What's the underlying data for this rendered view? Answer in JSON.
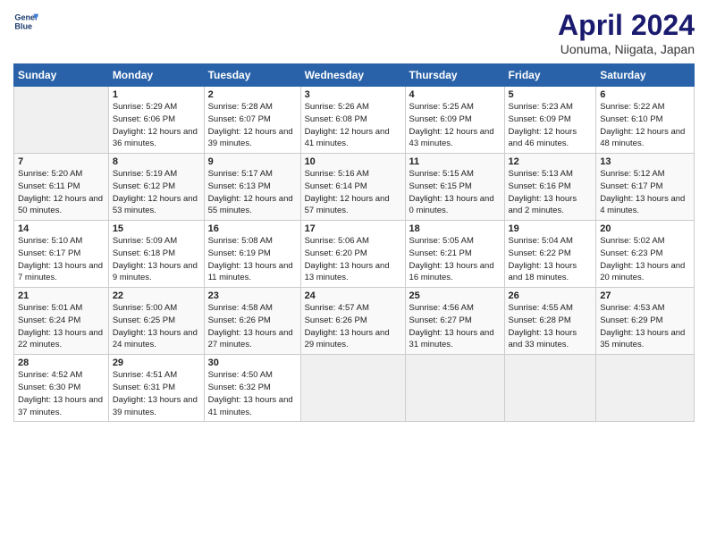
{
  "header": {
    "logo_line1": "General",
    "logo_line2": "Blue",
    "title": "April 2024",
    "subtitle": "Uonuma, Niigata, Japan"
  },
  "days_of_week": [
    "Sunday",
    "Monday",
    "Tuesday",
    "Wednesday",
    "Thursday",
    "Friday",
    "Saturday"
  ],
  "weeks": [
    [
      {
        "day": "",
        "empty": true
      },
      {
        "day": "1",
        "sunrise": "Sunrise: 5:29 AM",
        "sunset": "Sunset: 6:06 PM",
        "daylight": "Daylight: 12 hours and 36 minutes."
      },
      {
        "day": "2",
        "sunrise": "Sunrise: 5:28 AM",
        "sunset": "Sunset: 6:07 PM",
        "daylight": "Daylight: 12 hours and 39 minutes."
      },
      {
        "day": "3",
        "sunrise": "Sunrise: 5:26 AM",
        "sunset": "Sunset: 6:08 PM",
        "daylight": "Daylight: 12 hours and 41 minutes."
      },
      {
        "day": "4",
        "sunrise": "Sunrise: 5:25 AM",
        "sunset": "Sunset: 6:09 PM",
        "daylight": "Daylight: 12 hours and 43 minutes."
      },
      {
        "day": "5",
        "sunrise": "Sunrise: 5:23 AM",
        "sunset": "Sunset: 6:09 PM",
        "daylight": "Daylight: 12 hours and 46 minutes."
      },
      {
        "day": "6",
        "sunrise": "Sunrise: 5:22 AM",
        "sunset": "Sunset: 6:10 PM",
        "daylight": "Daylight: 12 hours and 48 minutes."
      }
    ],
    [
      {
        "day": "7",
        "sunrise": "Sunrise: 5:20 AM",
        "sunset": "Sunset: 6:11 PM",
        "daylight": "Daylight: 12 hours and 50 minutes."
      },
      {
        "day": "8",
        "sunrise": "Sunrise: 5:19 AM",
        "sunset": "Sunset: 6:12 PM",
        "daylight": "Daylight: 12 hours and 53 minutes."
      },
      {
        "day": "9",
        "sunrise": "Sunrise: 5:17 AM",
        "sunset": "Sunset: 6:13 PM",
        "daylight": "Daylight: 12 hours and 55 minutes."
      },
      {
        "day": "10",
        "sunrise": "Sunrise: 5:16 AM",
        "sunset": "Sunset: 6:14 PM",
        "daylight": "Daylight: 12 hours and 57 minutes."
      },
      {
        "day": "11",
        "sunrise": "Sunrise: 5:15 AM",
        "sunset": "Sunset: 6:15 PM",
        "daylight": "Daylight: 13 hours and 0 minutes."
      },
      {
        "day": "12",
        "sunrise": "Sunrise: 5:13 AM",
        "sunset": "Sunset: 6:16 PM",
        "daylight": "Daylight: 13 hours and 2 minutes."
      },
      {
        "day": "13",
        "sunrise": "Sunrise: 5:12 AM",
        "sunset": "Sunset: 6:17 PM",
        "daylight": "Daylight: 13 hours and 4 minutes."
      }
    ],
    [
      {
        "day": "14",
        "sunrise": "Sunrise: 5:10 AM",
        "sunset": "Sunset: 6:17 PM",
        "daylight": "Daylight: 13 hours and 7 minutes."
      },
      {
        "day": "15",
        "sunrise": "Sunrise: 5:09 AM",
        "sunset": "Sunset: 6:18 PM",
        "daylight": "Daylight: 13 hours and 9 minutes."
      },
      {
        "day": "16",
        "sunrise": "Sunrise: 5:08 AM",
        "sunset": "Sunset: 6:19 PM",
        "daylight": "Daylight: 13 hours and 11 minutes."
      },
      {
        "day": "17",
        "sunrise": "Sunrise: 5:06 AM",
        "sunset": "Sunset: 6:20 PM",
        "daylight": "Daylight: 13 hours and 13 minutes."
      },
      {
        "day": "18",
        "sunrise": "Sunrise: 5:05 AM",
        "sunset": "Sunset: 6:21 PM",
        "daylight": "Daylight: 13 hours and 16 minutes."
      },
      {
        "day": "19",
        "sunrise": "Sunrise: 5:04 AM",
        "sunset": "Sunset: 6:22 PM",
        "daylight": "Daylight: 13 hours and 18 minutes."
      },
      {
        "day": "20",
        "sunrise": "Sunrise: 5:02 AM",
        "sunset": "Sunset: 6:23 PM",
        "daylight": "Daylight: 13 hours and 20 minutes."
      }
    ],
    [
      {
        "day": "21",
        "sunrise": "Sunrise: 5:01 AM",
        "sunset": "Sunset: 6:24 PM",
        "daylight": "Daylight: 13 hours and 22 minutes."
      },
      {
        "day": "22",
        "sunrise": "Sunrise: 5:00 AM",
        "sunset": "Sunset: 6:25 PM",
        "daylight": "Daylight: 13 hours and 24 minutes."
      },
      {
        "day": "23",
        "sunrise": "Sunrise: 4:58 AM",
        "sunset": "Sunset: 6:26 PM",
        "daylight": "Daylight: 13 hours and 27 minutes."
      },
      {
        "day": "24",
        "sunrise": "Sunrise: 4:57 AM",
        "sunset": "Sunset: 6:26 PM",
        "daylight": "Daylight: 13 hours and 29 minutes."
      },
      {
        "day": "25",
        "sunrise": "Sunrise: 4:56 AM",
        "sunset": "Sunset: 6:27 PM",
        "daylight": "Daylight: 13 hours and 31 minutes."
      },
      {
        "day": "26",
        "sunrise": "Sunrise: 4:55 AM",
        "sunset": "Sunset: 6:28 PM",
        "daylight": "Daylight: 13 hours and 33 minutes."
      },
      {
        "day": "27",
        "sunrise": "Sunrise: 4:53 AM",
        "sunset": "Sunset: 6:29 PM",
        "daylight": "Daylight: 13 hours and 35 minutes."
      }
    ],
    [
      {
        "day": "28",
        "sunrise": "Sunrise: 4:52 AM",
        "sunset": "Sunset: 6:30 PM",
        "daylight": "Daylight: 13 hours and 37 minutes."
      },
      {
        "day": "29",
        "sunrise": "Sunrise: 4:51 AM",
        "sunset": "Sunset: 6:31 PM",
        "daylight": "Daylight: 13 hours and 39 minutes."
      },
      {
        "day": "30",
        "sunrise": "Sunrise: 4:50 AM",
        "sunset": "Sunset: 6:32 PM",
        "daylight": "Daylight: 13 hours and 41 minutes."
      },
      {
        "day": "",
        "empty": true
      },
      {
        "day": "",
        "empty": true
      },
      {
        "day": "",
        "empty": true
      },
      {
        "day": "",
        "empty": true
      }
    ]
  ]
}
